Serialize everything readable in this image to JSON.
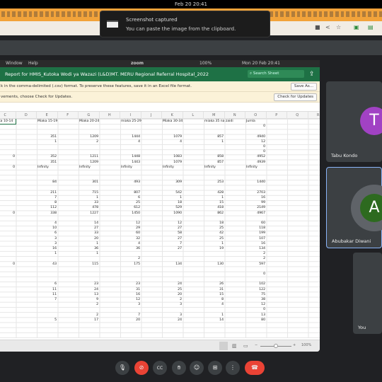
{
  "system": {
    "datetime": "Feb 20  20:41"
  },
  "toast": {
    "title": "Screenshot captured",
    "message": "You can paste the image from the clipboard."
  },
  "mac_menu": {
    "items": [
      "Window",
      "Help"
    ],
    "zoom_label": "zoom",
    "battery": "100%",
    "datetime": "Mon 20 Feb  20:41"
  },
  "excel": {
    "title": "Report for HMIS_Kutoka Wodi ya Wazazi (L&D)MT. MERU Regional Referral Hospital_2022",
    "search_placeholder": "Search Sheet",
    "csv_notice": "k in the comma-delimited (.csv) format. To preserve these features, save it in an Excel file format.",
    "save_as": "Save As...",
    "update_notice": "vements, choose Check for Updates.",
    "check_updates": "Check for Updates",
    "columns": [
      "C",
      "D",
      "E",
      "F",
      "G",
      "H",
      "I",
      "J",
      "K",
      "L",
      "M",
      "N",
      "O",
      "P",
      "Q",
      "R"
    ],
    "data_columns": [
      "C",
      "E",
      "G",
      "I",
      "K",
      "M",
      "O"
    ],
    "rows": [
      [
        "iaka 10-14",
        "Miaka 15-19",
        "Miaka 20-24",
        "miaka 25-29",
        "Miaka 30-34",
        "miaka 35 na zaidi",
        "Jumla"
      ],
      [
        "",
        "",
        "",
        "",
        "",
        "",
        "0"
      ],
      [
        "",
        "",
        "",
        "",
        "",
        "",
        ""
      ],
      [
        "",
        "351",
        "1209",
        "1444",
        "1079",
        "857",
        "4940"
      ],
      [
        "",
        "1",
        "2",
        "4",
        "4",
        "1",
        "12"
      ],
      [
        "",
        "",
        "",
        "",
        "",
        "",
        "0"
      ],
      [
        "",
        "",
        "",
        "",
        "",
        "",
        "0"
      ],
      [
        "0",
        "352",
        "1211",
        "1448",
        "1083",
        "858",
        "4952"
      ],
      [
        "",
        "351",
        "1209",
        "1443",
        "1079",
        "857",
        "4939"
      ],
      [
        "0",
        "Infinity",
        "Infinity",
        "Infinity",
        "Infinity",
        "Infinity",
        "Infinity"
      ],
      [
        "",
        "",
        "",
        "",
        "",
        "",
        ""
      ],
      [
        "",
        "",
        "",
        "",
        "",
        "",
        ""
      ],
      [
        "",
        "84",
        "301",
        "493",
        "309",
        "253",
        "1440"
      ],
      [
        "",
        "",
        "",
        "",
        "",
        "",
        ""
      ],
      [
        "",
        "211",
        "715",
        "807",
        "542",
        "428",
        "2703"
      ],
      [
        "",
        "7",
        "1",
        "6",
        "1",
        "1",
        "16"
      ],
      [
        "",
        "8",
        "33",
        "25",
        "18",
        "15",
        "99"
      ],
      [
        "",
        "112",
        "478",
        "612",
        "529",
        "418",
        "2149"
      ],
      [
        "0",
        "338",
        "1227",
        "1450",
        "1090",
        "862",
        "4967"
      ],
      [
        "",
        "",
        "",
        "",
        "",
        "",
        ""
      ],
      [
        "",
        "4",
        "14",
        "12",
        "12",
        "18",
        "60"
      ],
      [
        "",
        "10",
        "27",
        "29",
        "27",
        "25",
        "118"
      ],
      [
        "",
        "6",
        "33",
        "60",
        "58",
        "42",
        "199"
      ],
      [
        "",
        "3",
        "20",
        "32",
        "27",
        "25",
        "107"
      ],
      [
        "",
        "3",
        "1",
        "4",
        "7",
        "1",
        "16"
      ],
      [
        "",
        "16",
        "36",
        "36",
        "27",
        "19",
        "134"
      ],
      [
        "",
        "1",
        "1",
        "",
        "",
        "",
        "2"
      ],
      [
        "",
        "",
        "",
        "2",
        "",
        "",
        "2"
      ],
      [
        "0",
        "43",
        "115",
        "175",
        "134",
        "130",
        "597"
      ],
      [
        "",
        "",
        "",
        "",
        "",
        "",
        ""
      ],
      [
        "",
        "",
        "",
        "",
        "",
        "",
        "0"
      ],
      [
        "",
        "",
        "",
        "",
        "",
        "",
        ""
      ],
      [
        "",
        "6",
        "23",
        "23",
        "24",
        "26",
        "102"
      ],
      [
        "",
        "11",
        "24",
        "31",
        "25",
        "31",
        "122"
      ],
      [
        "",
        "11",
        "13",
        "16",
        "20",
        "15",
        "75"
      ],
      [
        "",
        "7",
        "9",
        "12",
        "2",
        "8",
        "38"
      ],
      [
        "",
        "",
        "2",
        "3",
        "3",
        "4",
        "12"
      ],
      [
        "",
        "",
        "",
        "",
        "",
        "",
        "0"
      ],
      [
        "",
        "",
        "2",
        "7",
        "3",
        "1",
        "13"
      ],
      [
        "",
        "5",
        "17",
        "20",
        "24",
        "14",
        "80"
      ]
    ],
    "zoom_level": "100%"
  },
  "participants": [
    {
      "name": "Tabu Kondo",
      "initial": "T",
      "color": "#a142c4"
    },
    {
      "name": "Abubakar Diwani",
      "initial": "A",
      "color": "#2d6a1f",
      "speaking": true
    },
    {
      "name": "You"
    }
  ],
  "controls": [
    "mic-icon",
    "camera-off-icon",
    "captions-icon",
    "raise-hand-icon",
    "emoji-icon",
    "present-icon",
    "more-icon",
    "end-call-icon"
  ],
  "colors": {
    "excel_green": "#1e7145",
    "end_call": "#ea4335",
    "active_border": "#8ab4f8"
  }
}
